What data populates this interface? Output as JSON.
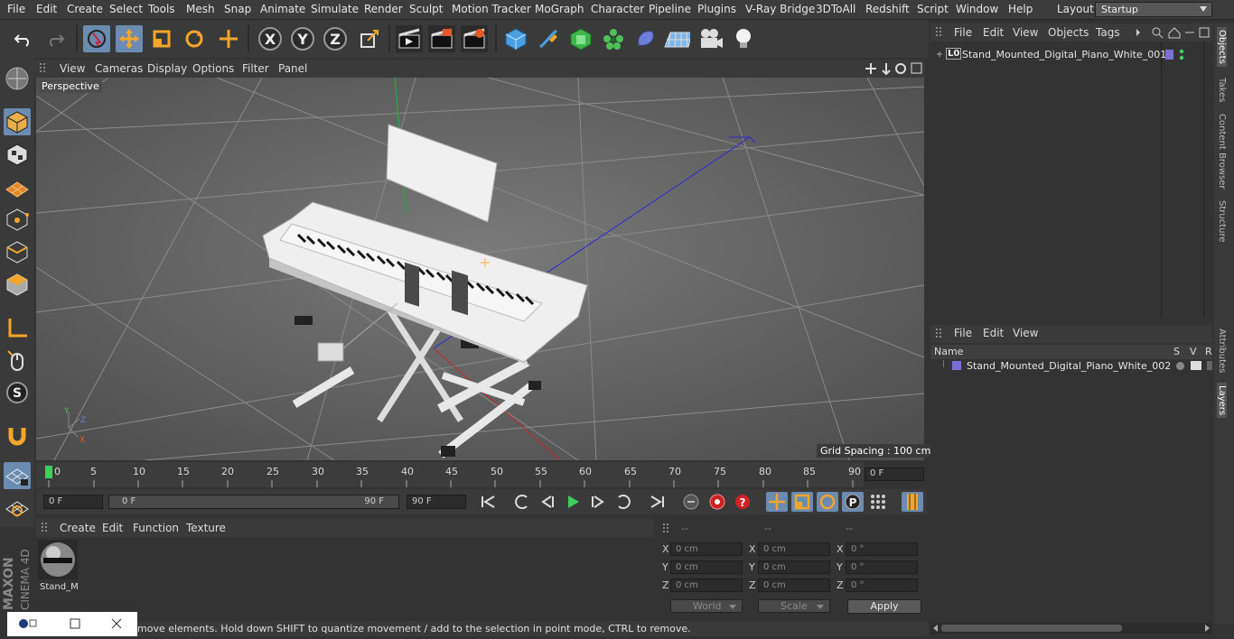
{
  "menubar": {
    "items": [
      "File",
      "Edit",
      "Create",
      "Select",
      "Tools",
      "Mesh",
      "Snap",
      "Animate",
      "Simulate",
      "Render",
      "Sculpt",
      "Motion Tracker",
      "MoGraph",
      "Character",
      "Pipeline",
      "Plugins",
      "V-Ray Bridge",
      "3DToAll",
      "Redshift",
      "Script",
      "Window",
      "Help"
    ],
    "layout_label": "Layout:",
    "layout_value": "Startup"
  },
  "toolbar": {
    "icons": [
      "undo-icon",
      "redo-icon",
      "live-selection-icon",
      "move-icon",
      "scale-icon",
      "rotate-icon",
      "recent-tool-icon",
      "x-axis-icon",
      "y-axis-icon",
      "z-axis-icon",
      "coordinate-system-icon",
      "render-view-icon",
      "render-picture-viewer-icon",
      "render-settings-icon",
      "cube-icon",
      "pen-icon",
      "subdivision-icon",
      "cloner-icon",
      "deformer-icon",
      "floor-icon",
      "camera-icon",
      "light-icon"
    ],
    "axis_labels": {
      "x": "X",
      "y": "Y",
      "z": "Z"
    }
  },
  "viewport": {
    "menu": [
      "View",
      "Cameras",
      "Display",
      "Options",
      "Filter",
      "Panel"
    ],
    "label": "Perspective",
    "grid_spacing": "Grid Spacing : 100 cm"
  },
  "timeline": {
    "ticks": [
      "0",
      "5",
      "10",
      "15",
      "20",
      "25",
      "30",
      "35",
      "40",
      "45",
      "50",
      "55",
      "60",
      "65",
      "70",
      "75",
      "80",
      "85",
      "90"
    ],
    "current_frame_right": "0 F"
  },
  "transport": {
    "start_frame": "0 F",
    "range_start": "0 F",
    "range_end": "90 F",
    "end_frame": "90 F"
  },
  "materials": {
    "menu": [
      "Create",
      "Edit",
      "Function",
      "Texture"
    ],
    "items": [
      {
        "name": "Stand_M"
      }
    ]
  },
  "coordinates": {
    "headers": [
      "--",
      "--",
      "--"
    ],
    "rows": [
      {
        "label": "X",
        "pos": "0 cm",
        "size": "0 cm",
        "rot_label": "X",
        "rot": "0 °"
      },
      {
        "label": "Y",
        "pos": "0 cm",
        "size": "0 cm",
        "rot_label": "Y",
        "rot": "0 °"
      },
      {
        "label": "Z",
        "pos": "0 cm",
        "size": "0 cm",
        "rot_label": "Z",
        "rot": "0 °"
      }
    ],
    "mode": "World",
    "measure": "Scale",
    "apply": "Apply"
  },
  "status": {
    "text": "move elements. Hold down SHIFT to quantize movement / add to the selection in point mode, CTRL to remove."
  },
  "objects_panel": {
    "menu": [
      "File",
      "Edit",
      "View",
      "Objects",
      "Tags"
    ],
    "object_name": "Stand_Mounted_Digital_Piano_White_001",
    "object_badge": "L0"
  },
  "layers_panel": {
    "menu": [
      "File",
      "Edit",
      "View"
    ],
    "columns": {
      "name": "Name",
      "s": "S",
      "v": "V",
      "r": "R"
    },
    "layer_name": "Stand_Mounted_Digital_Piano_White_002"
  },
  "side_tabs": [
    "Objects",
    "Takes",
    "Content Browser",
    "Structure",
    "Attributes",
    "Layers"
  ],
  "brand": {
    "maxon": "MAXON",
    "product": "CINEMA 4D"
  },
  "colors": {
    "accent": "#6b8bb0",
    "layer_color": "#7b6fd6"
  }
}
